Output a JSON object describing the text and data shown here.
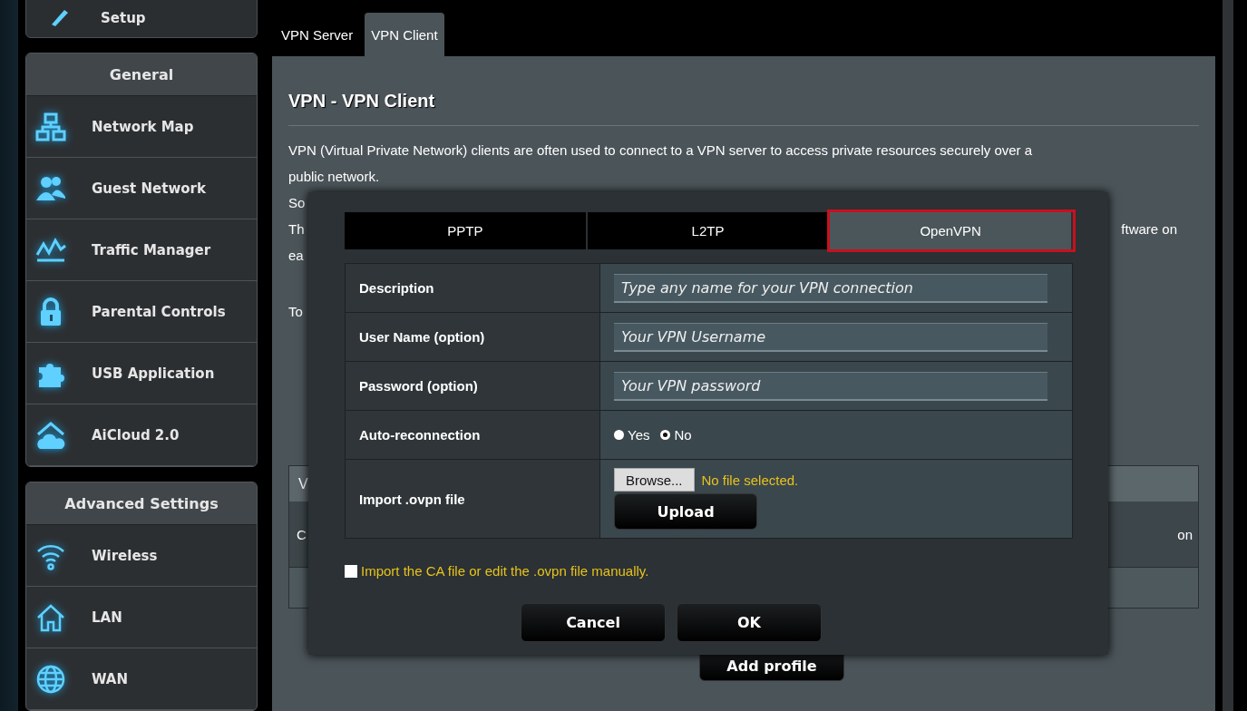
{
  "sidebar": {
    "top_item": {
      "label": "Setup"
    },
    "sections": [
      {
        "title": "General",
        "items": [
          {
            "label": "Network Map"
          },
          {
            "label": "Guest Network"
          },
          {
            "label": "Traffic Manager"
          },
          {
            "label": "Parental Controls"
          },
          {
            "label": "USB Application"
          },
          {
            "label": "AiCloud 2.0"
          }
        ]
      },
      {
        "title": "Advanced Settings",
        "items": [
          {
            "label": "Wireless"
          },
          {
            "label": "LAN"
          },
          {
            "label": "WAN"
          }
        ]
      }
    ]
  },
  "tabs": [
    {
      "label": "VPN Server",
      "selected": false
    },
    {
      "label": "VPN Client",
      "selected": true
    }
  ],
  "page": {
    "title": "VPN - VPN Client",
    "description": [
      "VPN (Virtual Private Network) clients are often used to connect to a VPN server to access private resources securely over a",
      "public network."
    ],
    "obscured_lines": [
      {
        "left": "So"
      },
      {
        "left": "Th",
        "right": "ftware on"
      },
      {
        "left": "ea"
      },
      {
        "left": "To"
      }
    ],
    "table": {
      "header_fragment": "V",
      "row_left": "C",
      "row_right": "on"
    },
    "add_profile_button": "Add profile"
  },
  "dialog": {
    "protocol_tabs": [
      {
        "label": "PPTP",
        "selected": false
      },
      {
        "label": "L2TP",
        "selected": false
      },
      {
        "label": "OpenVPN",
        "selected": true
      }
    ],
    "fields": [
      {
        "label": "Description",
        "placeholder": "Type any name for your VPN connection"
      },
      {
        "label": "User Name (option)",
        "placeholder": "Your VPN Username"
      },
      {
        "label": "Password (option)",
        "placeholder": "Your VPN password"
      }
    ],
    "auto_reconnection": {
      "label": "Auto-reconnection",
      "options": [
        {
          "label": "Yes",
          "selected": false
        },
        {
          "label": "No",
          "selected": true
        }
      ]
    },
    "import_file": {
      "label": "Import .ovpn file",
      "browse_button": "Browse...",
      "file_status": "No file selected.",
      "upload_button": "Upload"
    },
    "manual_option": {
      "label": "Import the CA file or edit the .ovpn file manually.",
      "checked": false
    },
    "buttons": [
      "Cancel",
      "OK"
    ]
  }
}
